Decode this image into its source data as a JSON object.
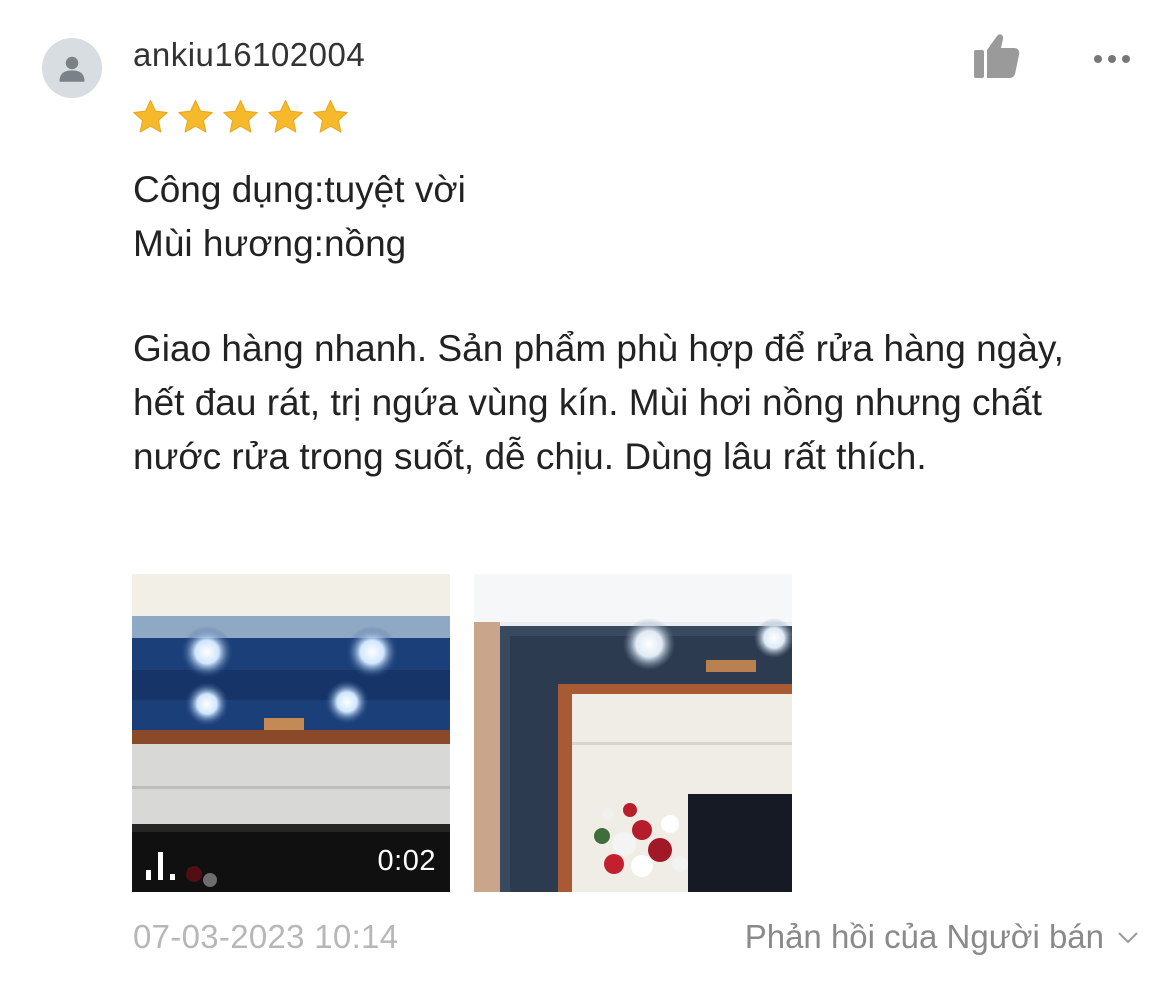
{
  "review": {
    "username": "ankiu16102004",
    "rating": 5,
    "rating_max": 5,
    "attributes": [
      "Công dụng:tuyệt vời",
      "Mùi hương:nồng"
    ],
    "text": "Giao hàng nhanh. Sản phẩm phù hợp để rửa hàng ngày, hết đau rát, trị ngứa vùng kín. Mùi hơi nồng nhưng chất nước rửa trong suốt, dễ chịu. Dùng lâu rất thích.",
    "media": [
      {
        "type": "video",
        "duration": "0:02"
      },
      {
        "type": "image"
      }
    ],
    "timestamp": "07-03-2023 10:14",
    "seller_reply_label": "Phản hồi của Người bán"
  },
  "icons": {
    "avatar": "person-icon",
    "like": "thumbs-up-icon",
    "more": "more-horizontal-icon",
    "star": "star-icon",
    "video": "video-bars-icon",
    "expand": "chevron-down-icon"
  },
  "colors": {
    "star": "#f6b92b",
    "text": "#222222",
    "muted": "#b7b7b7",
    "reply": "#8a8a8a",
    "avatar_bg": "#d8dde2"
  }
}
